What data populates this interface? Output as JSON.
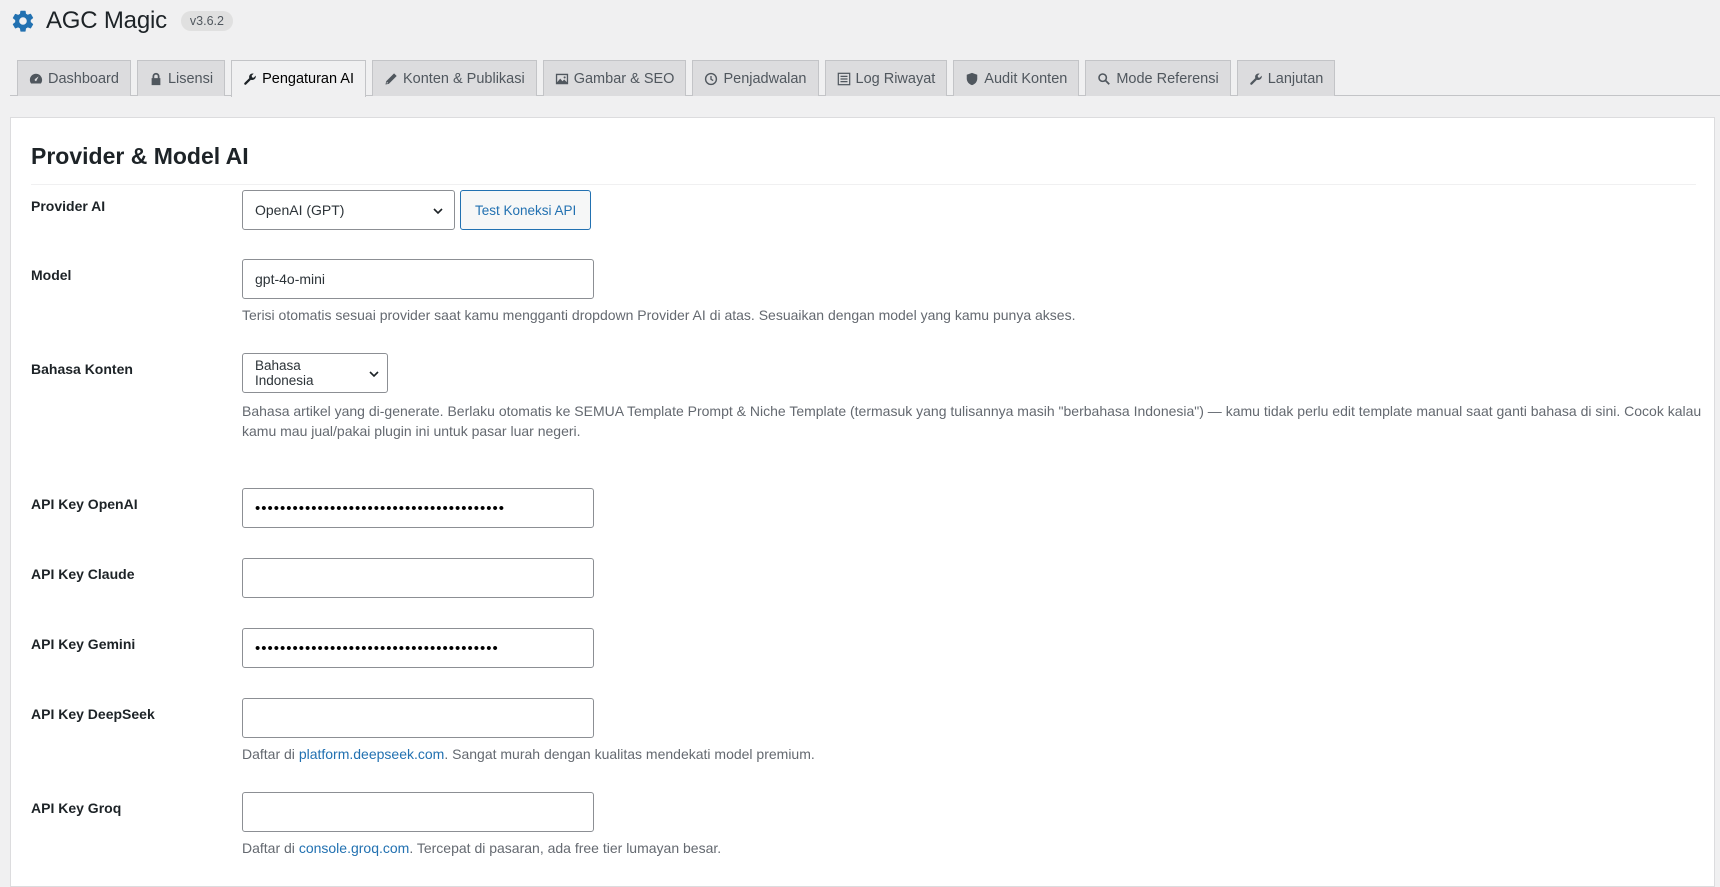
{
  "app": {
    "title": "AGC Magic",
    "version": "v3.6.2",
    "logo_icon": "gear-icon"
  },
  "tabs": [
    {
      "label": "Dashboard",
      "icon": "dashboard-icon",
      "active": false
    },
    {
      "label": "Lisensi",
      "icon": "lock-icon",
      "active": false
    },
    {
      "label": "Pengaturan AI",
      "icon": "wrench-icon",
      "active": true
    },
    {
      "label": "Konten & Publikasi",
      "icon": "pencil-icon",
      "active": false
    },
    {
      "label": "Gambar & SEO",
      "icon": "image-icon",
      "active": false
    },
    {
      "label": "Penjadwalan",
      "icon": "clock-icon",
      "active": false
    },
    {
      "label": "Log Riwayat",
      "icon": "list-icon",
      "active": false
    },
    {
      "label": "Audit Konten",
      "icon": "shield-icon",
      "active": false
    },
    {
      "label": "Mode Referensi",
      "icon": "search-icon",
      "active": false
    },
    {
      "label": "Lanjutan",
      "icon": "wrench-icon",
      "active": false
    }
  ],
  "section": {
    "title": "Provider & Model AI"
  },
  "fields": {
    "provider": {
      "label": "Provider AI",
      "value": "OpenAI (GPT)",
      "test_button": "Test Koneksi API"
    },
    "model": {
      "label": "Model",
      "value": "gpt-4o-mini",
      "description": "Terisi otomatis sesuai provider saat kamu mengganti dropdown Provider AI di atas. Sesuaikan dengan model yang kamu punya akses."
    },
    "language": {
      "label": "Bahasa Konten",
      "value": "Bahasa Indonesia",
      "description_line1": "Bahasa artikel yang di-generate. Berlaku otomatis ke SEMUA Template Prompt & Niche Template (termasuk yang tulisannya masih \"berbahasa Indonesia\") — kamu tidak perlu edit template manual saat ganti bahasa di sini. Cocok kalau",
      "description_line2": "kamu mau jual/pakai plugin ini untuk pasar luar negeri."
    },
    "openai_key": {
      "label": "API Key OpenAI",
      "value": "••••••••••••••••••••••••••••••••••••••••"
    },
    "claude_key": {
      "label": "API Key Claude",
      "value": ""
    },
    "gemini_key": {
      "label": "API Key Gemini",
      "value": "•••••••••••••••••••••••••••••••••••••••"
    },
    "deepseek_key": {
      "label": "API Key DeepSeek",
      "value": "",
      "desc_prefix": "Daftar di ",
      "desc_link": "platform.deepseek.com",
      "desc_suffix": ". Sangat murah dengan kualitas mendekati model premium."
    },
    "groq_key": {
      "label": "API Key Groq",
      "value": "",
      "desc_prefix": "Daftar di ",
      "desc_link": "console.groq.com",
      "desc_suffix": ". Tercepat di pasaran, ada free tier lumayan besar."
    }
  },
  "colors": {
    "accent": "#2271b1",
    "logo": "#2271b1"
  }
}
